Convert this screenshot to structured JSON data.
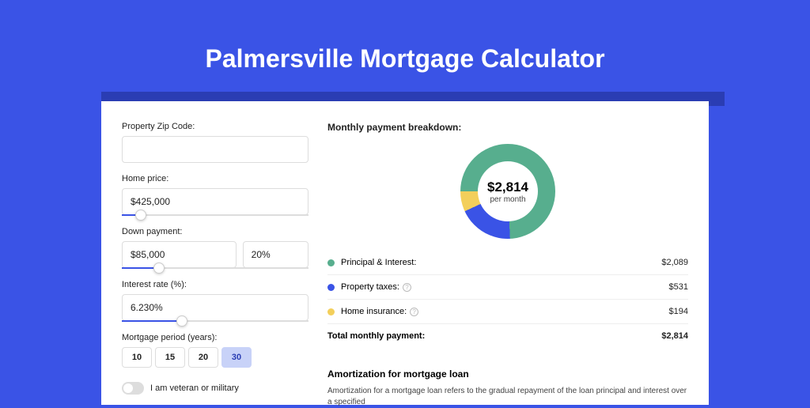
{
  "title": "Palmersville Mortgage Calculator",
  "form": {
    "zip_label": "Property Zip Code:",
    "zip_value": "",
    "home_price_label": "Home price:",
    "home_price_value": "$425,000",
    "home_price_slider_pct": 10,
    "down_payment_label": "Down payment:",
    "down_payment_value": "$85,000",
    "down_payment_pct_value": "20%",
    "down_payment_slider_pct": 20,
    "interest_label": "Interest rate (%):",
    "interest_value": "6.230%",
    "interest_slider_pct": 32,
    "period_label": "Mortgage period (years):",
    "period_options": [
      "10",
      "15",
      "20",
      "30"
    ],
    "period_selected": "30",
    "veteran_label": "I am veteran or military"
  },
  "breakdown": {
    "title": "Monthly payment breakdown:",
    "center_amount": "$2,814",
    "center_sub": "per month",
    "items": [
      {
        "label": "Principal & Interest:",
        "value": "$2,089",
        "color": "#57ae8e",
        "has_help": false
      },
      {
        "label": "Property taxes:",
        "value": "$531",
        "color": "#3a53e6",
        "has_help": true
      },
      {
        "label": "Home insurance:",
        "value": "$194",
        "color": "#f3cf5b",
        "has_help": true
      }
    ],
    "total_label": "Total monthly payment:",
    "total_value": "$2,814"
  },
  "chart_data": {
    "type": "pie",
    "title": "Monthly payment breakdown",
    "series": [
      {
        "name": "Principal & Interest",
        "value": 2089,
        "color": "#57ae8e"
      },
      {
        "name": "Property taxes",
        "value": 531,
        "color": "#3a53e6"
      },
      {
        "name": "Home insurance",
        "value": 194,
        "color": "#f3cf5b"
      }
    ],
    "total": 2814,
    "center_label": "$2,814 per month"
  },
  "amortization": {
    "title": "Amortization for mortgage loan",
    "text": "Amortization for a mortgage loan refers to the gradual repayment of the loan principal and interest over a specified"
  }
}
